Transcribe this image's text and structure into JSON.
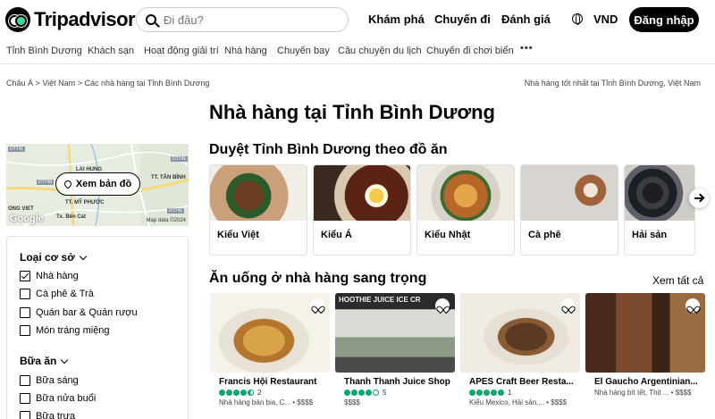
{
  "header": {
    "logo_text": "Tripadvisor",
    "search_placeholder": "Đi đâu?",
    "nav": [
      "Khám phá",
      "Chuyến đi",
      "Đánh giá"
    ],
    "currency": "VND",
    "login": "Đăng nhập"
  },
  "subnav": [
    "Tỉnh Bình Dương",
    "Khách sạn",
    "Hoạt động giải trí",
    "Nhà hàng",
    "Chuyến bay",
    "Câu chuyện du lịch",
    "Chuyến đi chơi biển"
  ],
  "breadcrumb": {
    "items": [
      "Châu Á",
      "Việt Nam",
      "Các nhà hàng tại Tỉnh Bình Dương"
    ],
    "separator": ">",
    "right": "Nhà hàng tốt nhất tại Tỉnh Bình Dương, Việt Nam"
  },
  "page_title": "Nhà hàng tại Tỉnh Bình Dương",
  "map": {
    "button": "Xem bản đồ",
    "labels": [
      "LAI HUNG",
      "TT. TÂN BÌNH",
      "TT. MỸ PHƯỚC",
      "Tx. Bến Cát",
      "ONG VIET"
    ],
    "roads": [
      "DT741",
      "DT749",
      "DT742",
      "DT741"
    ],
    "google": "Google",
    "data": "Map data ©2024"
  },
  "filters": {
    "type_heading": "Loại cơ sở",
    "types": [
      {
        "label": "Nhà hàng",
        "checked": true
      },
      {
        "label": "Cà phê & Trà",
        "checked": false
      },
      {
        "label": "Quán bar & Quán rượu",
        "checked": false
      },
      {
        "label": "Món tráng miệng",
        "checked": false
      }
    ],
    "meal_heading": "Bữa ăn",
    "meals": [
      {
        "label": "Bữa sáng",
        "checked": false
      },
      {
        "label": "Bữa nửa buổi",
        "checked": false
      },
      {
        "label": "Bữa trưa",
        "checked": false
      }
    ]
  },
  "cuisines": {
    "title": "Duyệt Tỉnh Bình Dương theo đồ ăn",
    "items": [
      {
        "label": "Kiểu Việt"
      },
      {
        "label": "Kiểu Á"
      },
      {
        "label": "Kiểu Nhật"
      },
      {
        "label": "Cà phê"
      },
      {
        "label": "Hải sản"
      }
    ]
  },
  "fine_dining": {
    "title": "Ăn uống ở nhà hàng sang trọng",
    "see_all": "Xem tất cả",
    "items": [
      {
        "name": "Francis Hội Restaurant",
        "rating": 4.5,
        "count": "2",
        "meta": "Nhà hàng bán bia, C... • $$$$"
      },
      {
        "name": "Thanh Thanh Juice Shop",
        "rating": 4,
        "count": "5",
        "meta": "$$$$",
        "sign": "HOOTHIE JUICE ICE CR"
      },
      {
        "name": "APES Craft Beer Resta...",
        "rating": 5,
        "count": "1",
        "meta": "Kiểu Mexico, Hải sản,... • $$$$"
      },
      {
        "name": "El Gaucho Argentinian...",
        "rating": null,
        "count": "",
        "meta": "Nhà hàng bít tết, Thịt ... • $$$$"
      }
    ]
  },
  "colors": {
    "accent": "#00aa6c",
    "brand": "#000000"
  }
}
